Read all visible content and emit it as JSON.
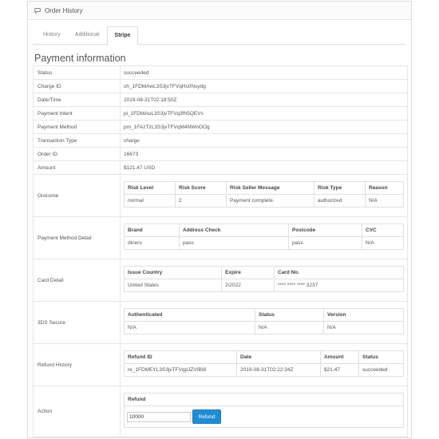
{
  "panel": {
    "title": "Order History"
  },
  "tabs": [
    {
      "label": "History"
    },
    {
      "label": "Additional"
    },
    {
      "label": "Stripe"
    }
  ],
  "section_title": "Payment information",
  "rows": [
    {
      "label": "Status",
      "value": "succeeded"
    },
    {
      "label": "Charge ID",
      "value": "ch_1FDMAwL3S3jvTFVqHs0Nsydg"
    },
    {
      "label": "Date/Time",
      "value": "2019-08-31T02:18:50Z"
    },
    {
      "label": "Payment Intent",
      "value": "pi_1FDMAuL3S3jvTFVq3fh5QEVs"
    },
    {
      "label": "Payment Method",
      "value": "pm_1FAzTzL3S3jvTFVqM4NWnOOg"
    },
    {
      "label": "Transaction Type",
      "value": "charge"
    },
    {
      "label": "Order ID",
      "value": "16673"
    },
    {
      "label": "Amount",
      "value": "$121.47 USD"
    }
  ],
  "outcome": {
    "label": "Outcome",
    "headers": [
      "Risk Level",
      "Risk Score",
      "Risk Seller Message",
      "Risk Type",
      "Reason"
    ],
    "values": [
      "normal",
      "2",
      "Payment complete.",
      "authorized",
      "N/A"
    ]
  },
  "payment_method_detail": {
    "label": "Payment Method Detail",
    "headers": [
      "Brand",
      "Address Check",
      "Postcode",
      "CVC"
    ],
    "values": [
      "diners",
      "pass",
      "pass",
      "N/A"
    ]
  },
  "card_detail": {
    "label": "Card Detail",
    "headers": [
      "Issue Country",
      "Expire",
      "Card No."
    ],
    "values": [
      "United States",
      "2/2022",
      "**** **** **** 3237"
    ]
  },
  "secure_3ds": {
    "label": "3DS Secure",
    "headers": [
      "Authenticated",
      "Status",
      "Version"
    ],
    "values": [
      "N/A",
      "N/A",
      "N/A"
    ]
  },
  "refund_history": {
    "label": "Refund History",
    "headers": [
      "Refund ID",
      "Date",
      "Amount",
      "Status"
    ],
    "values": [
      "re_1FDMEYL3S3jvTFVqpJZVIBI8",
      "2019-08-31T02:22:34Z",
      "$21.47",
      "succeeded"
    ]
  },
  "action": {
    "label": "Action",
    "form_title": "Refund",
    "input_value": "10000",
    "button_label": "Refund"
  }
}
